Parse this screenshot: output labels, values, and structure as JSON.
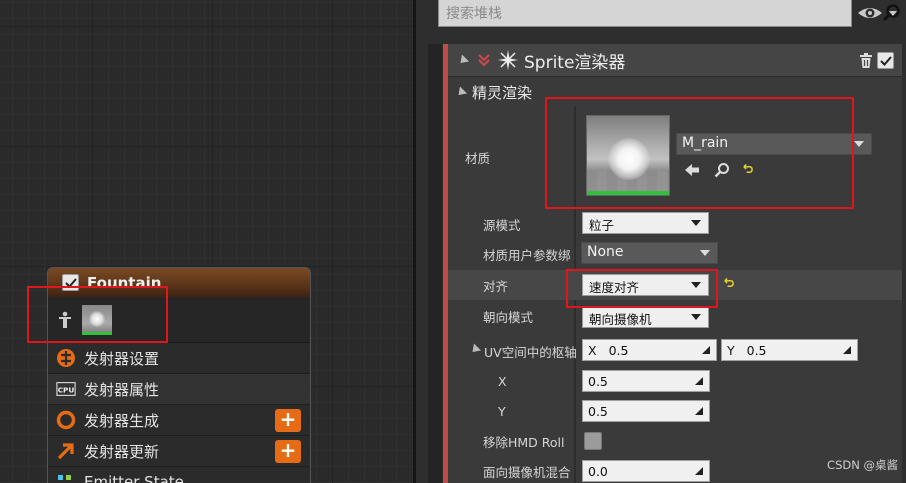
{
  "panel": {
    "search_placeholder": "搜索堆栈",
    "sprite_section": {
      "title": "Sprite渲染器",
      "subsection": "精灵渲染"
    },
    "properties": {
      "material": {
        "label": "材质",
        "value": "M_rain"
      },
      "source_mode": {
        "label": "源模式",
        "value": "粒子"
      },
      "material_user_param": {
        "label": "材质用户参数绑",
        "value": "None"
      },
      "alignment": {
        "label": "对齐",
        "value": "速度对齐"
      },
      "facing_mode": {
        "label": "朝向模式",
        "value": "朝向摄像机"
      },
      "uv_pivot": {
        "label": "UV空间中的枢轴",
        "x_label": "X",
        "x_value": "0.5",
        "y_label": "Y",
        "y_value": "0.5"
      },
      "pivot_x": {
        "label": "X",
        "value": "0.5"
      },
      "pivot_y": {
        "label": "Y",
        "value": "0.5"
      },
      "remove_hmd_roll": {
        "label": "移除HMD Roll"
      },
      "camera_blend": {
        "label": "面向摄像机混合",
        "value": "0.0"
      }
    }
  },
  "node": {
    "title": "Fountain",
    "rows": [
      {
        "label": "发射器设置",
        "icon": "emitter-settings-icon"
      },
      {
        "label": "发射器属性",
        "icon": "cpu-icon",
        "icon_text": "CPU"
      },
      {
        "label": "发射器生成",
        "icon": "emitter-spawn-icon",
        "add": "+"
      },
      {
        "label": "发射器更新",
        "icon": "emitter-update-icon",
        "add": "+"
      },
      {
        "label": "Emitter State",
        "icon": "state-icon"
      }
    ]
  },
  "watermark": "CSDN @桌酱",
  "colors": {
    "highlight_box": "#e0161d",
    "orange": "#e56b14",
    "material_bar": "#2fc23a"
  }
}
